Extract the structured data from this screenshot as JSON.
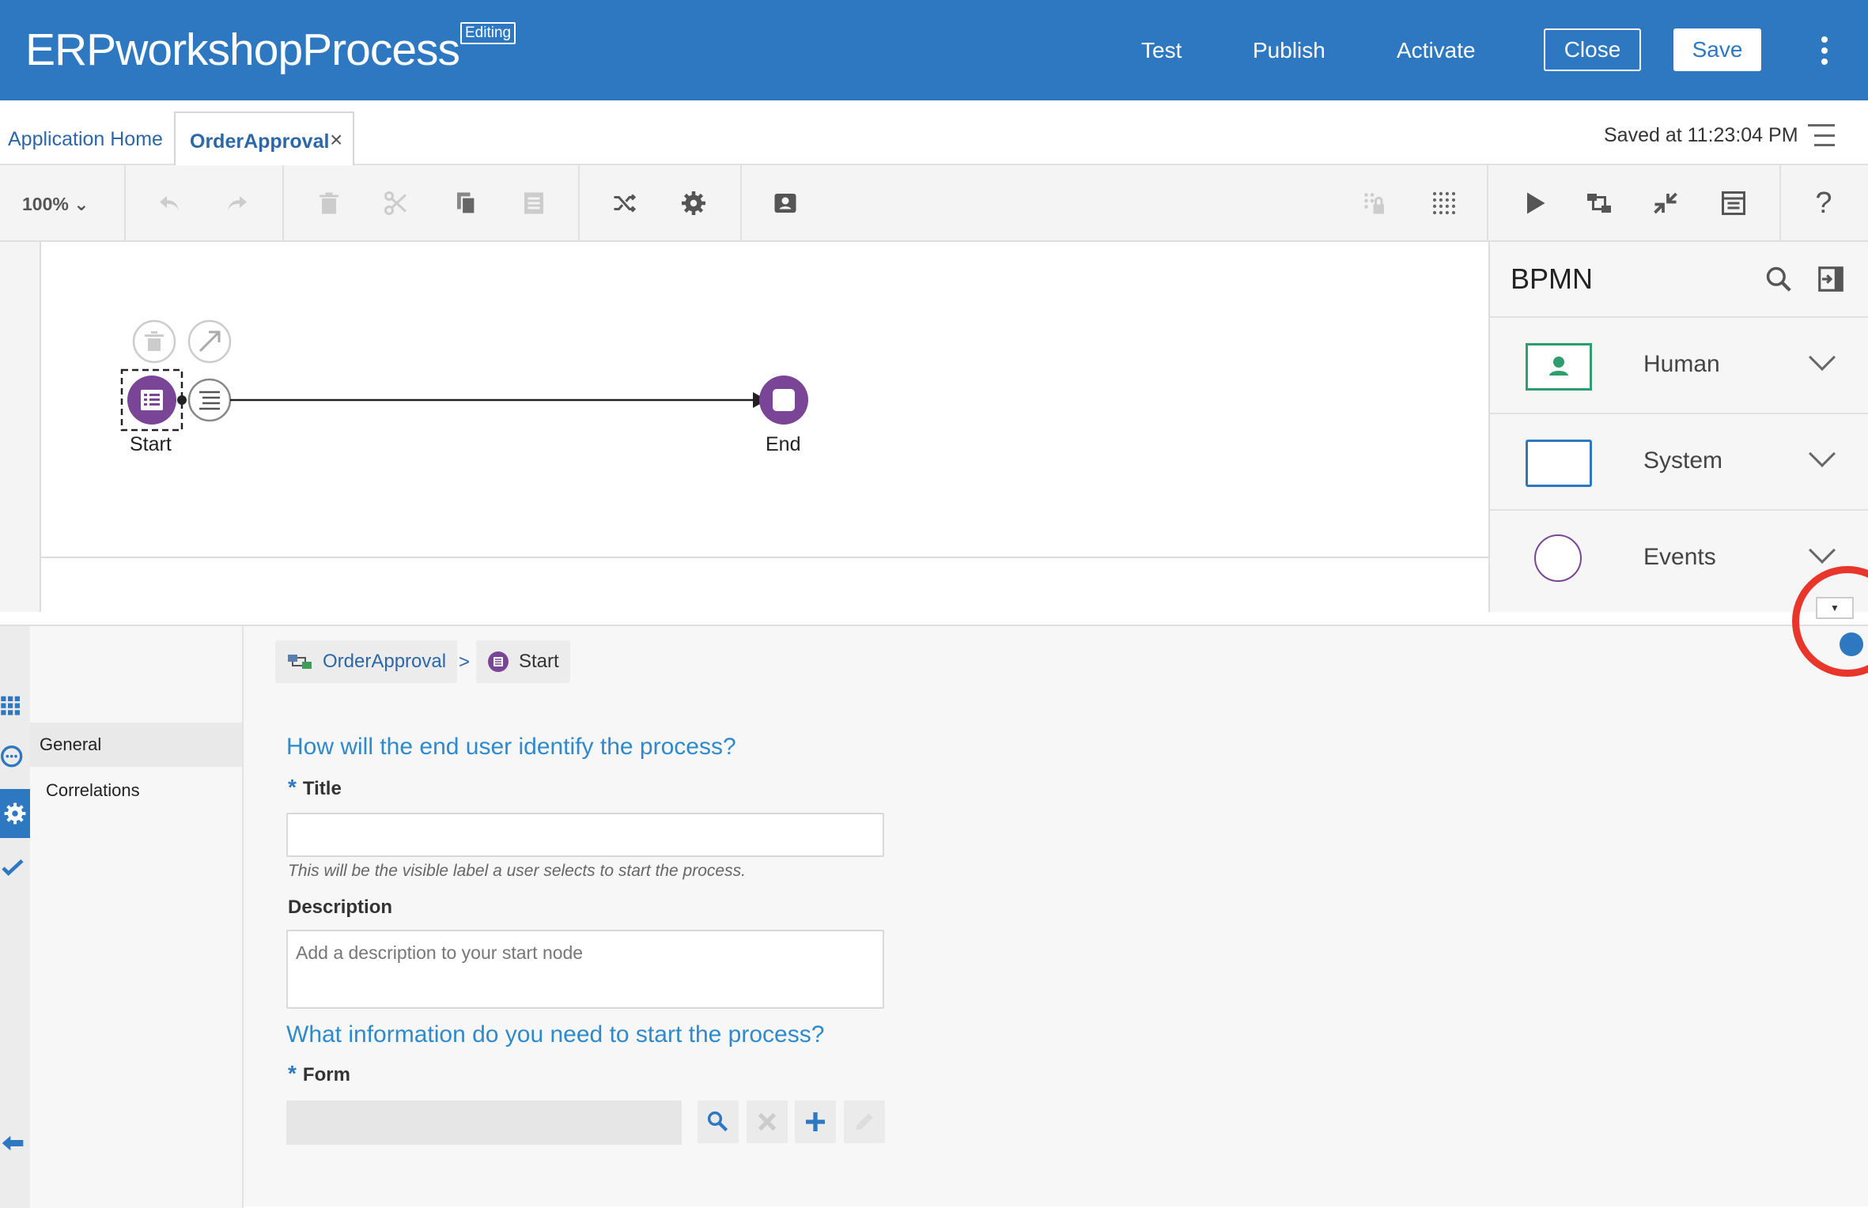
{
  "header": {
    "app_title": "ERPworkshopProcess",
    "badge": "Editing",
    "links": {
      "test": "Test",
      "publish": "Publish",
      "activate": "Activate"
    },
    "close_label": "Close",
    "save_label": "Save",
    "menu_icon": "kebab-menu-icon"
  },
  "tabs": {
    "home": "Application Home",
    "active": "OrderApproval",
    "close_glyph": "×",
    "saved_status": "Saved at 11:23:04 PM"
  },
  "toolbar": {
    "zoom": "100%",
    "icons": [
      "undo-icon",
      "redo-icon",
      "delete-icon",
      "cut-icon",
      "copy-icon",
      "paste-icon",
      "shuffle-icon",
      "settings-icon",
      "contact-card-icon",
      "lock-grid-icon",
      "grid-icon",
      "run-icon",
      "connect-icon",
      "collapse-icon",
      "report-icon",
      "help-icon"
    ],
    "help_glyph": "?"
  },
  "diagram": {
    "nodes": [
      {
        "id": "start",
        "label": "Start",
        "color": "#7b4597"
      },
      {
        "id": "end",
        "label": "End",
        "color": "#7b4597"
      }
    ]
  },
  "palette": {
    "title": "BPMN",
    "sections": [
      {
        "label": "Human",
        "icon": "human-task-icon"
      },
      {
        "label": "System",
        "icon": "system-task-icon"
      },
      {
        "label": "Events",
        "icon": "event-circle-icon"
      }
    ]
  },
  "properties": {
    "nav": [
      "General",
      "Correlations"
    ],
    "breadcrumb": {
      "process": "OrderApproval",
      "separator": ">",
      "node": "Start"
    },
    "q1": "How will the end user identify the process?",
    "title_label": "Title",
    "title_value": "",
    "title_hint": "This will be the visible label a user selects to start the process.",
    "description_label": "Description",
    "description_placeholder": "Add a description to your start node",
    "q2": "What information do you need to start the process?",
    "form_label": "Form",
    "required_mark": "*",
    "form_buttons": [
      "search-icon",
      "clear-icon",
      "add-icon",
      "edit-icon"
    ]
  },
  "colors": {
    "brand": "#2e78c2",
    "node": "#7b4597",
    "human": "#2e9e6e",
    "highlight": "#e8372a"
  }
}
